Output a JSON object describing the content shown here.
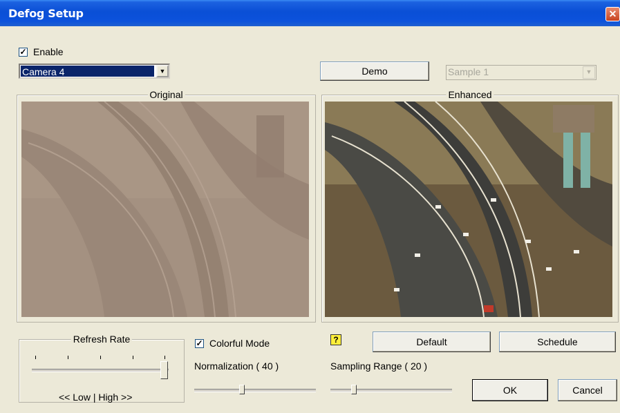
{
  "window": {
    "title": "Defog Setup",
    "close_glyph": "✕"
  },
  "enable": {
    "label": "Enable",
    "checked": true
  },
  "camera_select": {
    "value": "Camera 4"
  },
  "demo_button": "Demo",
  "sample_select": {
    "value": "Sample 1",
    "disabled": true
  },
  "panels": {
    "original_label": "Original",
    "enhanced_label": "Enhanced"
  },
  "refresh_rate": {
    "label": "Refresh Rate",
    "level_fraction": 1.0,
    "scale_text": "<< Low | High >>"
  },
  "colorful_mode": {
    "label": "Colorful Mode",
    "checked": true
  },
  "normalization": {
    "label": "Normalization  ( 40 )",
    "value": 40
  },
  "sampling_range": {
    "label": "Sampling Range  ( 20 )",
    "value": 20
  },
  "buttons": {
    "default": "Default",
    "schedule": "Schedule",
    "ok": "OK",
    "cancel": "Cancel"
  },
  "icons": {
    "help": "help-icon",
    "check": "checkmark-icon",
    "dropdown": "chevron-down-icon"
  },
  "colors": {
    "titlebar": "#0a4fd6",
    "dialog": "#ece9d8",
    "selection": "#0a246a"
  }
}
